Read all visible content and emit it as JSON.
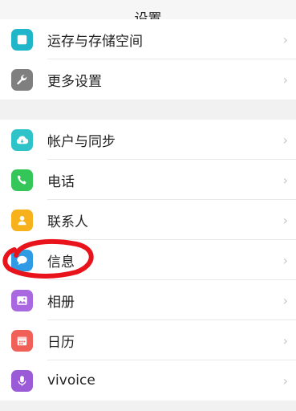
{
  "header": {
    "title": "设置"
  },
  "group1": [
    {
      "label": "运存与存储空间",
      "icon": "storage-icon",
      "color": "#1fb6c9"
    },
    {
      "label": "更多设置",
      "icon": "wrench-icon",
      "color": "#7f7f7f"
    }
  ],
  "group2": [
    {
      "label": "帐户与同步",
      "icon": "cloud-icon",
      "color": "#2dc3c8"
    },
    {
      "label": "电话",
      "icon": "phone-icon",
      "color": "#35c659"
    },
    {
      "label": "联系人",
      "icon": "contact-icon",
      "color": "#f6b11b"
    },
    {
      "label": "信息",
      "icon": "message-icon",
      "color": "#2e9be4"
    },
    {
      "label": "相册",
      "icon": "album-icon",
      "color": "#a968e0"
    },
    {
      "label": "日历",
      "icon": "calendar-icon",
      "color": "#f06058"
    },
    {
      "label": "vivoice",
      "icon": "microphone-icon",
      "color": "#9b5ad6"
    }
  ],
  "chevron": "›",
  "annotation_color": "#e8131b"
}
